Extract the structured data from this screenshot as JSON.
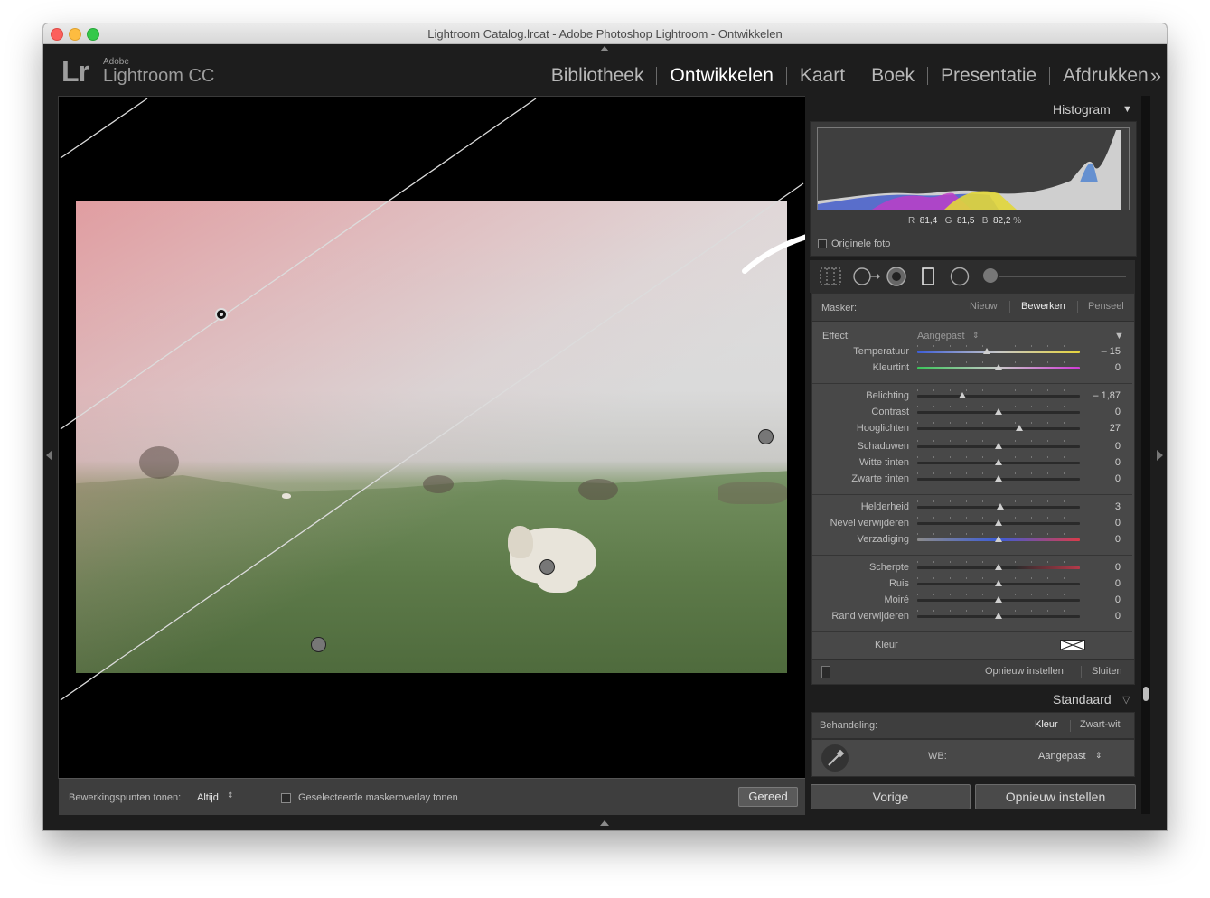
{
  "window": {
    "title": "Lightroom Catalog.lrcat - Adobe Photoshop Lightroom - Ontwikkelen"
  },
  "brand": {
    "logo": "Lr",
    "small": "Adobe",
    "name": "Lightroom CC"
  },
  "modules": [
    {
      "label": "Bibliotheek",
      "active": false
    },
    {
      "label": "Ontwikkelen",
      "active": true
    },
    {
      "label": "Kaart",
      "active": false
    },
    {
      "label": "Boek",
      "active": false
    },
    {
      "label": "Presentatie",
      "active": false
    },
    {
      "label": "Afdrukken",
      "active": false
    }
  ],
  "modules_more": "»",
  "toolbar": {
    "show_pins_label": "Bewerkingspunten tonen:",
    "show_pins_value": "Altijd",
    "overlay_label": "Geselecteerde maskeroverlay tonen",
    "done_label": "Gereed"
  },
  "histogram": {
    "title": "Histogram",
    "r_label": "R",
    "r_value": "81,4",
    "g_label": "G",
    "g_value": "81,5",
    "b_label": "B",
    "b_value": "82,2",
    "unit": "%",
    "original_label": "Originele foto"
  },
  "mask": {
    "label": "Masker:",
    "new_label": "Nieuw",
    "edit_label": "Bewerken",
    "brush_label": "Penseel"
  },
  "effect": {
    "label": "Effect:",
    "value": "Aangepast"
  },
  "sliders": [
    {
      "label": "Temperatuur",
      "value": "– 15",
      "pos": 0.43,
      "track": "temp"
    },
    {
      "label": "Kleurtint",
      "value": "0",
      "pos": 0.5,
      "track": "tint"
    },
    {
      "label": "Belichting",
      "value": "– 1,87",
      "pos": 0.28,
      "track": "plain"
    },
    {
      "label": "Contrast",
      "value": "0",
      "pos": 0.5,
      "track": "plain"
    },
    {
      "label": "Hooglichten",
      "value": "27",
      "pos": 0.63,
      "track": "plain"
    },
    {
      "label": "Schaduwen",
      "value": "0",
      "pos": 0.5,
      "track": "plain"
    },
    {
      "label": "Witte tinten",
      "value": "0",
      "pos": 0.5,
      "track": "plain"
    },
    {
      "label": "Zwarte tinten",
      "value": "0",
      "pos": 0.5,
      "track": "plain"
    },
    {
      "label": "Helderheid",
      "value": "3",
      "pos": 0.51,
      "track": "plain"
    },
    {
      "label": "Nevel verwijderen",
      "value": "0",
      "pos": 0.5,
      "track": "plain"
    },
    {
      "label": "Verzadiging",
      "value": "0",
      "pos": 0.5,
      "track": "sat"
    },
    {
      "label": "Scherpte",
      "value": "0",
      "pos": 0.5,
      "track": "sharp"
    },
    {
      "label": "Ruis",
      "value": "0",
      "pos": 0.5,
      "track": "plain"
    },
    {
      "label": "Moiré",
      "value": "0",
      "pos": 0.5,
      "track": "plain"
    },
    {
      "label": "Rand verwijderen",
      "value": "0",
      "pos": 0.5,
      "track": "plain"
    }
  ],
  "color_label": "Kleur",
  "panel_footer": {
    "reset_label": "Opnieuw instellen",
    "close_label": "Sluiten"
  },
  "basic": {
    "title": "Standaard",
    "treatment_label": "Behandeling:",
    "color_option": "Kleur",
    "bw_option": "Zwart-wit",
    "wb_label": "WB:",
    "wb_value": "Aangepast"
  },
  "buttons": {
    "previous": "Vorige",
    "reset": "Opnieuw instellen"
  },
  "colors": {
    "accent_white": "#ffffff",
    "panel_bg": "#484848",
    "app_bg": "#1d1d1d"
  }
}
